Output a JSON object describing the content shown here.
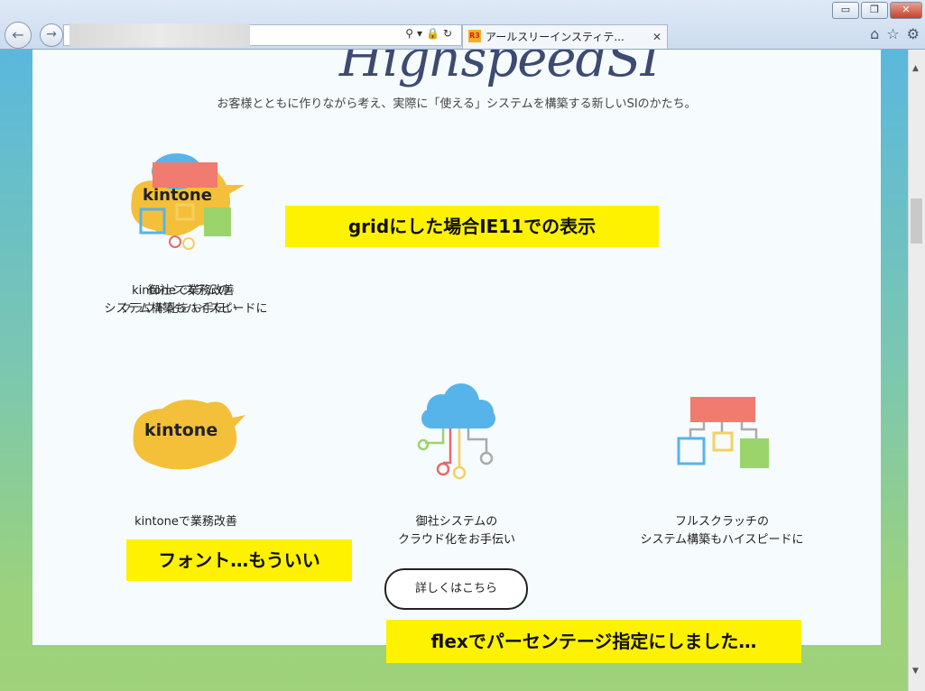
{
  "browser": {
    "tab_title": "アールスリーインスティテ...",
    "tab_close": "✕",
    "favicon_text": "R3",
    "address_icons": "⚲▾🔒↻",
    "back_glyph": "←",
    "forward_glyph": "→",
    "minimize": "▭",
    "restore": "❐",
    "close": "✕",
    "home_icon": "⌂",
    "star_icon": "☆",
    "gear_icon": "⚙"
  },
  "page": {
    "logo": "HighspeedSI",
    "tagline": "お客様とともに作りながら考え、実際に「使える」システムを構築する新しいSIのかたち。",
    "features": [
      {
        "label_line1": "kintoneで業務改善",
        "label_line2": ""
      },
      {
        "label_line1": "御社システムの",
        "label_line2": "クラウド化をお手伝い"
      },
      {
        "label_line1": "フルスクラッチの",
        "label_line2": "システム構築もハイスピードに"
      }
    ],
    "kintone_logo_text": "kintone",
    "cta_label": "詳しくはこちら"
  },
  "annotations": {
    "grid_note": "gridにした場合IE11での表示",
    "font_note": "フォント…もういい",
    "flex_note": "flexでパーセンテージ指定にしました…"
  },
  "colors": {
    "kintone_yellow": "#f4c03a",
    "cloud_blue": "#56b4ea",
    "scratch_red": "#f07b6e",
    "green_box": "#9bd46a",
    "note_yellow": "#fff200"
  }
}
